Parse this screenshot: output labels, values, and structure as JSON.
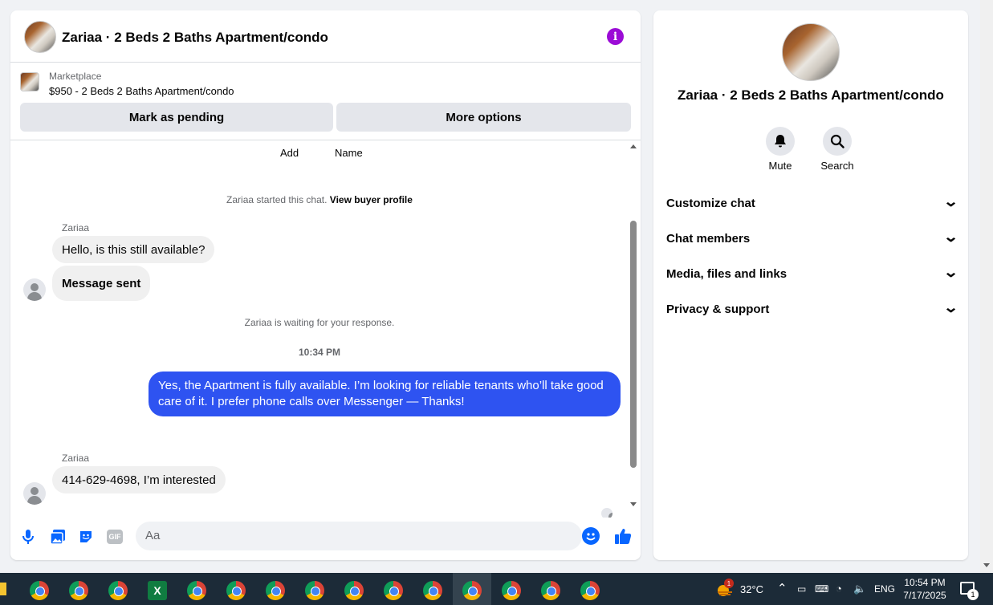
{
  "chat": {
    "title": "Zariaa · 2 Beds 2 Baths Apartment/condo",
    "marketplace_label": "Marketplace",
    "listing": "$950 - 2 Beds 2 Baths Apartment/condo",
    "mark_pending": "Mark as pending",
    "more_options": "More options",
    "top_actions": [
      "Add",
      "Name"
    ],
    "started_text": "Zariaa started this chat.",
    "view_profile": "View buyer profile",
    "sender1": "Zariaa",
    "msg1": "Hello, is this still available?",
    "msg2": "Message sent",
    "waiting": "Zariaa is waiting for your response.",
    "time": "10:34 PM",
    "own_msg": "Yes, the Apartment is fully available. I’m looking for reliable tenants who’ll take good care of it. I prefer phone calls over Messenger —  Thanks!",
    "sender2": "Zariaa",
    "msg3": "414-629-4698, I’m interested",
    "input_placeholder": "Aa"
  },
  "info": {
    "title": "Zariaa · 2 Beds 2 Baths Apartment/condo",
    "mute": "Mute",
    "search": "Search",
    "sections": [
      "Customize chat",
      "Chat members",
      "Media, files and links",
      "Privacy & support"
    ]
  },
  "taskbar": {
    "temperature": "32°C",
    "lang": "ENG",
    "time": "10:54 PM",
    "date": "7/17/2025",
    "weather_badge": "1",
    "notif_badge": "1"
  },
  "colors": {
    "accent": "#2e53f1",
    "info_icon": "#9b0bd6",
    "like": "#0866ff"
  },
  "scrollbar_position": 0.65
}
